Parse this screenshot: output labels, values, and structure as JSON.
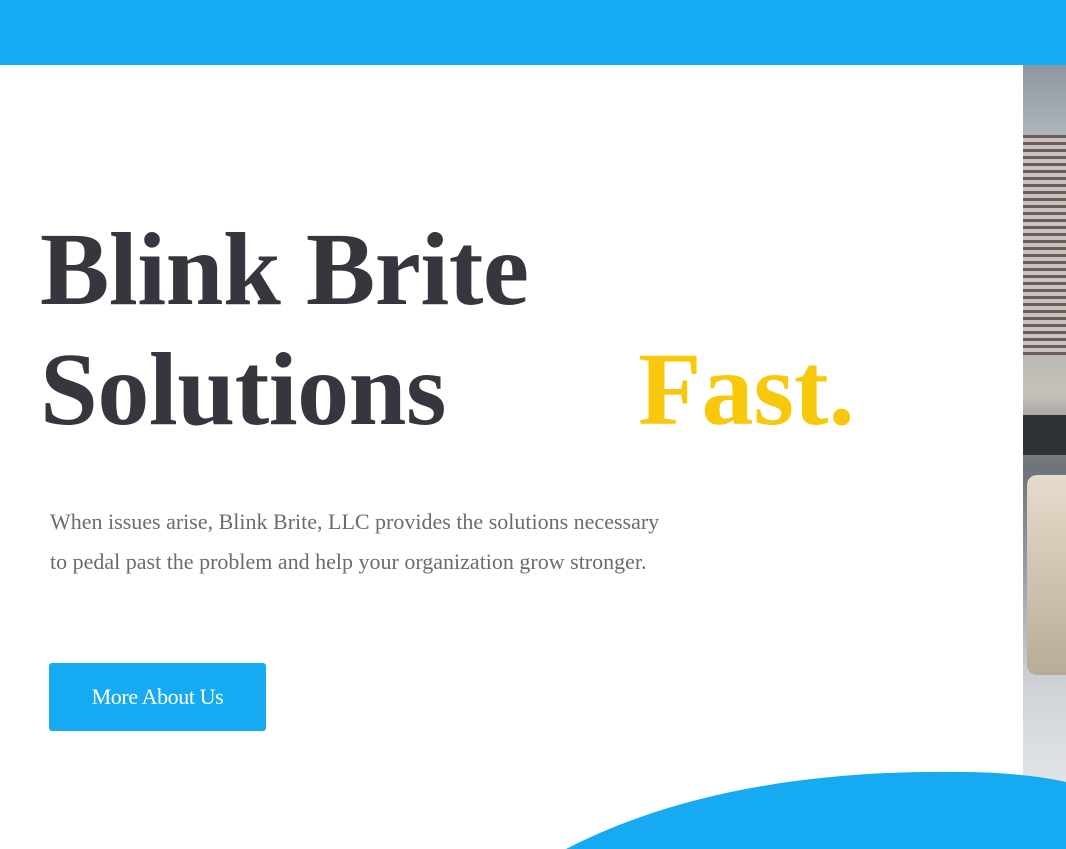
{
  "hero": {
    "title_line1": "Blink Brite",
    "title_line2": "Solutions",
    "accent_word": "Fast.",
    "description_line1": "When issues arise, Blink Brite, LLC provides the solutions necessary",
    "description_line2": "to pedal past the problem and help your organization grow stronger.",
    "cta_label": "More About Us"
  },
  "colors": {
    "brand_blue": "#16aaf2",
    "accent_yellow": "#f8c80c",
    "heading_text": "#37363f",
    "body_text": "#6b6b70"
  },
  "icons": {
    "hero_image": "office-photo"
  }
}
